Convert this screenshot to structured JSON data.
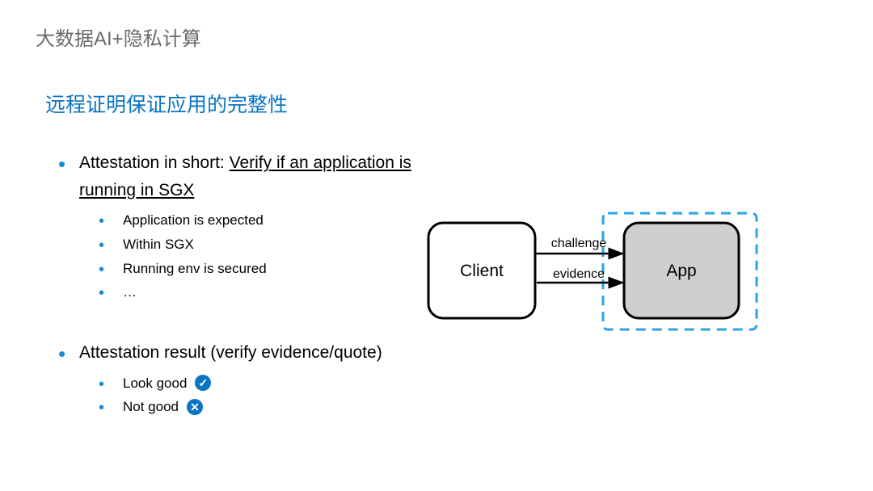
{
  "header": "大数据AI+隐私计算",
  "title": "远程证明保证应用的完整性",
  "sec1": {
    "lead": "Attestation in short: ",
    "lead_underline": "Verify if an application is running in SGX",
    "items": [
      "Application is expected",
      "Within SGX",
      "Running env is secured",
      "…"
    ]
  },
  "sec2": {
    "lead": "Attestation result (verify evidence/quote)",
    "items": [
      {
        "label": "Look good",
        "mark": "✓"
      },
      {
        "label": "Not good",
        "mark": "✕"
      }
    ]
  },
  "diagram": {
    "left_box": "Client",
    "right_box": "App",
    "top_arrow": "challenge",
    "bottom_arrow": "evidence"
  }
}
